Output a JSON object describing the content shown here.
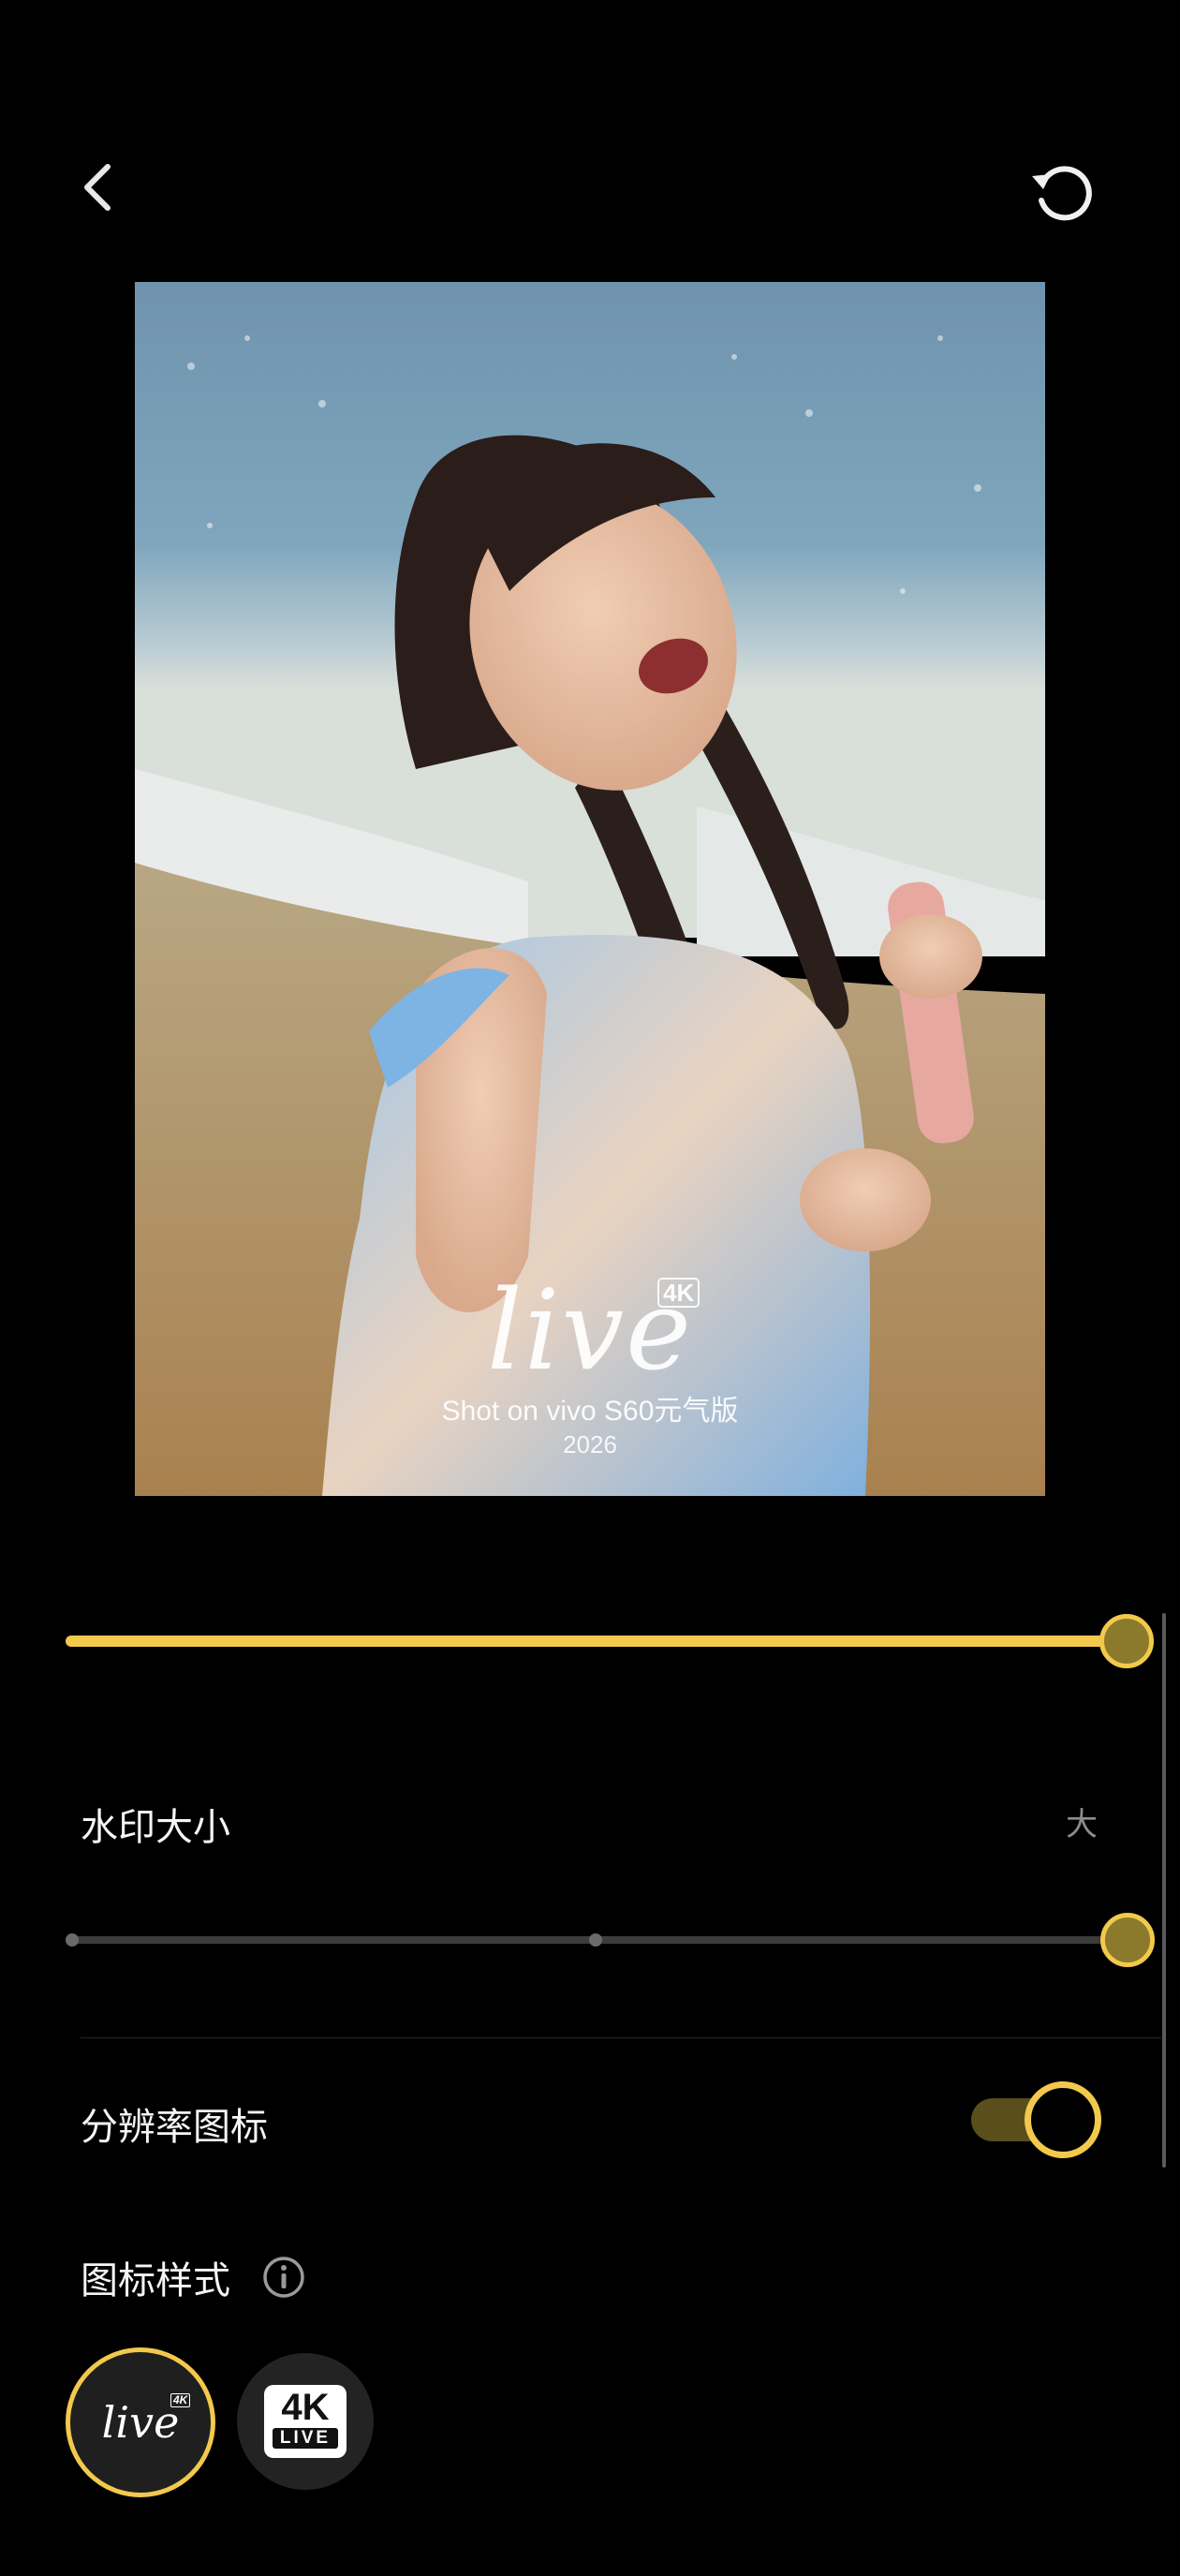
{
  "icons": {
    "back": "chevron-left-icon",
    "reset": "reset-icon",
    "info": "info-icon"
  },
  "photo": {
    "watermark_script": "live",
    "watermark_badge": "4K",
    "shot_on": "Shot on vivo S60元气版",
    "year": "2026"
  },
  "opacity_slider": {
    "value_fraction": 1.0
  },
  "watermark_size": {
    "label": "水印大小",
    "value": "大",
    "slider_fraction": 1.0
  },
  "resolution_icon": {
    "label": "分辨率图标",
    "enabled": true
  },
  "icon_style": {
    "label": "图标样式",
    "options": [
      {
        "script": "live",
        "badge": "4K",
        "selected": true
      },
      {
        "top": "4K",
        "bottom": "LIVE",
        "selected": false
      }
    ]
  },
  "colors": {
    "accent": "#f2c94c",
    "background": "#000000",
    "track_inactive": "#3c3c3c"
  }
}
